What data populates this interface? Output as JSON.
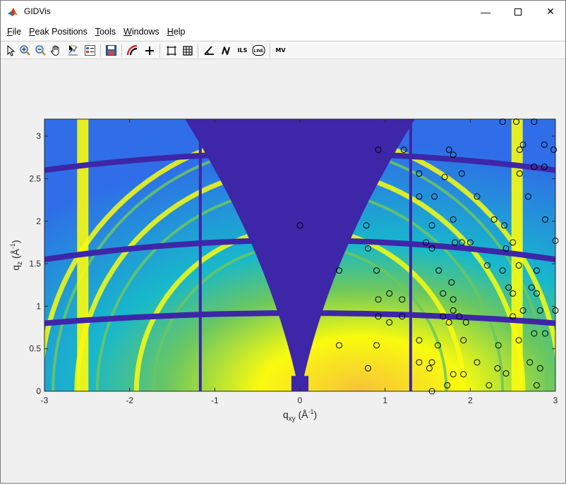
{
  "window": {
    "title": "GIDVis",
    "min_glyph": "—",
    "close_glyph": "✕"
  },
  "menu": [
    {
      "pre": "",
      "u": "F",
      "post": "ile"
    },
    {
      "pre": "",
      "u": "P",
      "post": "eak Positions"
    },
    {
      "pre": "",
      "u": "T",
      "post": "ools"
    },
    {
      "pre": "",
      "u": "W",
      "post": "indows"
    },
    {
      "pre": "",
      "u": "H",
      "post": "elp"
    }
  ],
  "toolbar": {
    "icons": [
      "pointer-icon",
      "zoom-in-icon",
      "zoom-out-icon",
      "pan-hand-icon",
      "data-cursor-icon",
      "legend-icon",
      "save-icon",
      "ring-icon",
      "crosshair-icon",
      "rectangle-icon",
      "grid-icon",
      "angle-icon",
      "line-n-icon",
      "ils-icon",
      "line-icon",
      "mv-icon"
    ],
    "ils_label": "ILS",
    "line_label": "LINE",
    "mv_label": "MV"
  },
  "colors": {
    "deep": "#3e26a8",
    "blue": "#2f6ee8",
    "cyan": "#17b8cb",
    "green": "#6bc75f",
    "yellow": "#f9fb0e",
    "amber": "#f7c23a"
  },
  "chart_data": {
    "type": "scatter",
    "title": "",
    "xlabel_main": "q",
    "xlabel_sub": "xy",
    "xlabel_rest": " (Å",
    "xlabel_sup": "-1",
    "xlabel_end": ")",
    "ylabel_main": "q",
    "ylabel_sub": "z",
    "ylabel_rest": " (Å",
    "ylabel_sup": "-1",
    "ylabel_end": ")",
    "xlim": [
      -3,
      3
    ],
    "ylim": [
      0,
      3.2
    ],
    "xticks": [
      -3,
      -2,
      -1,
      0,
      1,
      2,
      3
    ],
    "xtick_labels": [
      "-3",
      "-2",
      "-1",
      "0",
      "1",
      "2",
      "3"
    ],
    "yticks": [
      0,
      0.5,
      1,
      1.5,
      2,
      2.5,
      3
    ],
    "ytick_labels": [
      "0",
      "0.5",
      "1",
      "1.5",
      "2",
      "2.5",
      "3"
    ],
    "series": [
      {
        "marker": "open-circle",
        "points": [
          [
            0.0,
            1.95
          ],
          [
            0.92,
            2.84
          ],
          [
            1.22,
            2.84
          ],
          [
            1.4,
            2.56
          ],
          [
            1.4,
            2.29
          ],
          [
            1.58,
            2.29
          ],
          [
            1.7,
            2.52
          ],
          [
            1.8,
            2.78
          ],
          [
            1.75,
            2.84
          ],
          [
            1.9,
            2.56
          ],
          [
            2.08,
            2.29
          ],
          [
            2.38,
            3.17
          ],
          [
            2.54,
            3.17
          ],
          [
            2.75,
            3.17
          ],
          [
            2.58,
            2.84
          ],
          [
            2.62,
            2.9
          ],
          [
            2.58,
            2.56
          ],
          [
            2.75,
            2.64
          ],
          [
            2.87,
            2.64
          ],
          [
            2.68,
            2.29
          ],
          [
            2.87,
            2.9
          ],
          [
            2.98,
            2.84
          ],
          [
            2.88,
            2.02
          ],
          [
            3.0,
            1.77
          ],
          [
            2.28,
            2.02
          ],
          [
            2.4,
            1.95
          ],
          [
            2.5,
            1.75
          ],
          [
            2.42,
            1.68
          ],
          [
            1.55,
            1.95
          ],
          [
            1.8,
            2.02
          ],
          [
            1.9,
            1.75
          ],
          [
            1.48,
            1.75
          ],
          [
            1.55,
            1.68
          ],
          [
            1.63,
            1.42
          ],
          [
            1.82,
            1.75
          ],
          [
            2.0,
            1.75
          ],
          [
            2.2,
            1.48
          ],
          [
            2.38,
            1.42
          ],
          [
            2.57,
            1.48
          ],
          [
            2.78,
            1.42
          ],
          [
            2.45,
            1.22
          ],
          [
            2.5,
            1.15
          ],
          [
            2.72,
            1.22
          ],
          [
            2.78,
            1.15
          ],
          [
            2.62,
            0.95
          ],
          [
            2.82,
            0.95
          ],
          [
            3.0,
            0.95
          ],
          [
            2.5,
            0.88
          ],
          [
            2.75,
            0.68
          ],
          [
            2.88,
            0.68
          ],
          [
            2.57,
            0.6
          ],
          [
            2.33,
            0.54
          ],
          [
            2.7,
            0.34
          ],
          [
            2.82,
            0.27
          ],
          [
            2.78,
            0.07
          ],
          [
            2.32,
            0.27
          ],
          [
            2.42,
            0.21
          ],
          [
            2.22,
            0.07
          ],
          [
            2.08,
            0.34
          ],
          [
            1.92,
            0.2
          ],
          [
            1.8,
            0.2
          ],
          [
            1.73,
            0.07
          ],
          [
            1.52,
            0.27
          ],
          [
            1.55,
            0.34
          ],
          [
            1.4,
            0.34
          ],
          [
            1.4,
            0.6
          ],
          [
            1.55,
            0.0
          ],
          [
            1.62,
            0.54
          ],
          [
            1.92,
            0.6
          ],
          [
            1.95,
            0.81
          ],
          [
            1.68,
            0.88
          ],
          [
            1.75,
            0.81
          ],
          [
            1.8,
            0.95
          ],
          [
            1.87,
            0.88
          ],
          [
            1.68,
            1.15
          ],
          [
            1.78,
            1.28
          ],
          [
            1.8,
            1.08
          ],
          [
            0.78,
            1.95
          ],
          [
            0.8,
            1.68
          ],
          [
            0.9,
            1.42
          ],
          [
            0.92,
            1.08
          ],
          [
            0.92,
            0.88
          ],
          [
            1.05,
            0.81
          ],
          [
            1.05,
            1.15
          ],
          [
            1.2,
            0.88
          ],
          [
            1.2,
            1.08
          ],
          [
            0.46,
            1.42
          ],
          [
            0.46,
            0.54
          ],
          [
            0.9,
            0.54
          ],
          [
            0.8,
            0.27
          ]
        ]
      }
    ]
  }
}
